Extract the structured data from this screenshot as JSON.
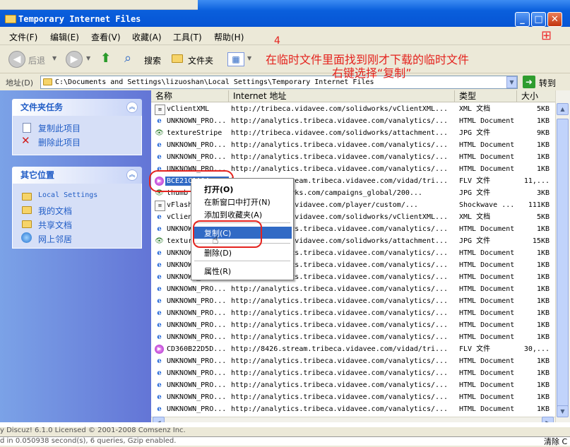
{
  "window": {
    "title": "Temporary Internet Files"
  },
  "menu": [
    "文件(F)",
    "编辑(E)",
    "查看(V)",
    "收藏(A)",
    "工具(T)",
    "帮助(H)"
  ],
  "toolbar": {
    "back": "后退",
    "search": "搜索",
    "folders": "文件夹"
  },
  "address": {
    "label": "地址(D)",
    "path": "C:\\Documents and Settings\\lizuoshan\\Local Settings\\Temporary Internet Files",
    "go": "转到"
  },
  "left_panel": {
    "tasks_title": "文件夹任务",
    "tasks": [
      "复制此项目",
      "删除此项目"
    ],
    "places_title": "其它位置",
    "places": [
      "Local Settings",
      "我的文档",
      "共享文档",
      "网上邻居"
    ]
  },
  "columns": [
    "名称",
    "Internet 地址",
    "类型",
    "大小"
  ],
  "rows": [
    {
      "icon": "doc",
      "name": "vClientXML",
      "addr": "http://tribeca.vidavee.com/solidworks/vClientXML...",
      "type": "XML 文档",
      "size": "5KB"
    },
    {
      "icon": "ie",
      "name": "UNKNOWN_PRO...",
      "addr": "http://analytics.tribeca.vidavee.com/vanalytics/...",
      "type": "HTML Document",
      "size": "1KB"
    },
    {
      "icon": "eye",
      "name": "textureStripe",
      "addr": "http://tribeca.vidavee.com/solidworks/attachment...",
      "type": "JPG 文件",
      "size": "9KB"
    },
    {
      "icon": "ie",
      "name": "UNKNOWN_PRO...",
      "addr": "http://analytics.tribeca.vidavee.com/vanalytics/...",
      "type": "HTML Document",
      "size": "1KB"
    },
    {
      "icon": "ie",
      "name": "UNKNOWN_PRO...",
      "addr": "http://analytics.tribeca.vidavee.com/vanalytics/...",
      "type": "HTML Document",
      "size": "1KB"
    },
    {
      "icon": "ie",
      "name": "UNKNOWN_PRO...",
      "addr": "http://analytics.tribeca.vidavee.com/vanalytics/...",
      "type": "HTML Document",
      "size": "1KB"
    },
    {
      "icon": "flv",
      "name": "BCE21C1A04...",
      "addr": "http://8792.stream.tribeca.vidavee.com/vidad/tri...",
      "type": "FLV 文件",
      "size": "11,..."
    },
    {
      "icon": "eye",
      "name": "thumb",
      "addr": "http://solidworks.com/campaigns_global/200...",
      "type": "JPG 文件",
      "size": "3KB"
    },
    {
      "icon": "doc",
      "name": "vFlash",
      "addr": "http://tribeca.vidavee.com/player/custom/...",
      "type": "Shockwave ...",
      "size": "111KB"
    },
    {
      "icon": "ie",
      "name": "vClient",
      "addr": "http://tribeca.vidavee.com/solidworks/vClientXML...",
      "type": "XML 文档",
      "size": "5KB"
    },
    {
      "icon": "ie",
      "name": "UNKNOWN_PRO...",
      "addr": "http://analytics.tribeca.vidavee.com/vanalytics/...",
      "type": "HTML Document",
      "size": "1KB"
    },
    {
      "icon": "eye",
      "name": "texture",
      "addr": "http://tribeca.vidavee.com/solidworks/attachment...",
      "type": "JPG 文件",
      "size": "15KB"
    },
    {
      "icon": "ie",
      "name": "UNKNOWN_PRO...",
      "addr": "http://analytics.tribeca.vidavee.com/vanalytics/...",
      "type": "HTML Document",
      "size": "1KB"
    },
    {
      "icon": "ie",
      "name": "UNKNOWN_PRO...",
      "addr": "http://analytics.tribeca.vidavee.com/vanalytics/...",
      "type": "HTML Document",
      "size": "1KB"
    },
    {
      "icon": "ie",
      "name": "UNKNOWN_PRO...",
      "addr": "http://analytics.tribeca.vidavee.com/vanalytics/...",
      "type": "HTML Document",
      "size": "1KB"
    },
    {
      "icon": "ie",
      "name": "UNKNOWN_PRO...",
      "addr": "http://analytics.tribeca.vidavee.com/vanalytics/...",
      "type": "HTML Document",
      "size": "1KB"
    },
    {
      "icon": "ie",
      "name": "UNKNOWN_PRO...",
      "addr": "http://analytics.tribeca.vidavee.com/vanalytics/...",
      "type": "HTML Document",
      "size": "1KB"
    },
    {
      "icon": "ie",
      "name": "UNKNOWN_PRO...",
      "addr": "http://analytics.tribeca.vidavee.com/vanalytics/...",
      "type": "HTML Document",
      "size": "1KB"
    },
    {
      "icon": "ie",
      "name": "UNKNOWN_PRO...",
      "addr": "http://analytics.tribeca.vidavee.com/vanalytics/...",
      "type": "HTML Document",
      "size": "1KB"
    },
    {
      "icon": "ie",
      "name": "UNKNOWN_PRO...",
      "addr": "http://analytics.tribeca.vidavee.com/vanalytics/...",
      "type": "HTML Document",
      "size": "1KB"
    },
    {
      "icon": "flv",
      "name": "CD360B22D5D...",
      "addr": "http://8426.stream.tribeca.vidavee.com/vidad/tri...",
      "type": "FLV 文件",
      "size": "30,..."
    },
    {
      "icon": "ie",
      "name": "UNKNOWN_PRO...",
      "addr": "http://analytics.tribeca.vidavee.com/vanalytics/...",
      "type": "HTML Document",
      "size": "1KB"
    },
    {
      "icon": "ie",
      "name": "UNKNOWN_PRO...",
      "addr": "http://analytics.tribeca.vidavee.com/vanalytics/...",
      "type": "HTML Document",
      "size": "1KB"
    },
    {
      "icon": "ie",
      "name": "UNKNOWN_PRO...",
      "addr": "http://analytics.tribeca.vidavee.com/vanalytics/...",
      "type": "HTML Document",
      "size": "1KB"
    },
    {
      "icon": "ie",
      "name": "UNKNOWN_PRO...",
      "addr": "http://analytics.tribeca.vidavee.com/vanalytics/...",
      "type": "HTML Document",
      "size": "1KB"
    },
    {
      "icon": "ie",
      "name": "UNKNOWN_PRO...",
      "addr": "http://analytics.tribeca.vidavee.com/vanalytics/...",
      "type": "HTML Document",
      "size": "1KB"
    }
  ],
  "context_menu": [
    "打开(O)",
    "在新窗口中打开(N)",
    "添加到收藏夹(A)",
    "复制(C)",
    "删除(D)",
    "属性(R)"
  ],
  "annotation": {
    "number": "4",
    "line1": "在临时文件里面找到刚才下载的临时文件",
    "line2": "右键选择“复制”"
  },
  "background": {
    "line1": "y Discuz! 6.1.0 Licensed © 2001-2008 Comsenz Inc.",
    "line2": "d in 0.050938 second(s), 6 queries, Gzip enabled.",
    "right": "清除  C"
  },
  "colors": {
    "accent": "#316ac5",
    "annotation": "#e4231e",
    "title_bar": "#0a5fdc"
  }
}
